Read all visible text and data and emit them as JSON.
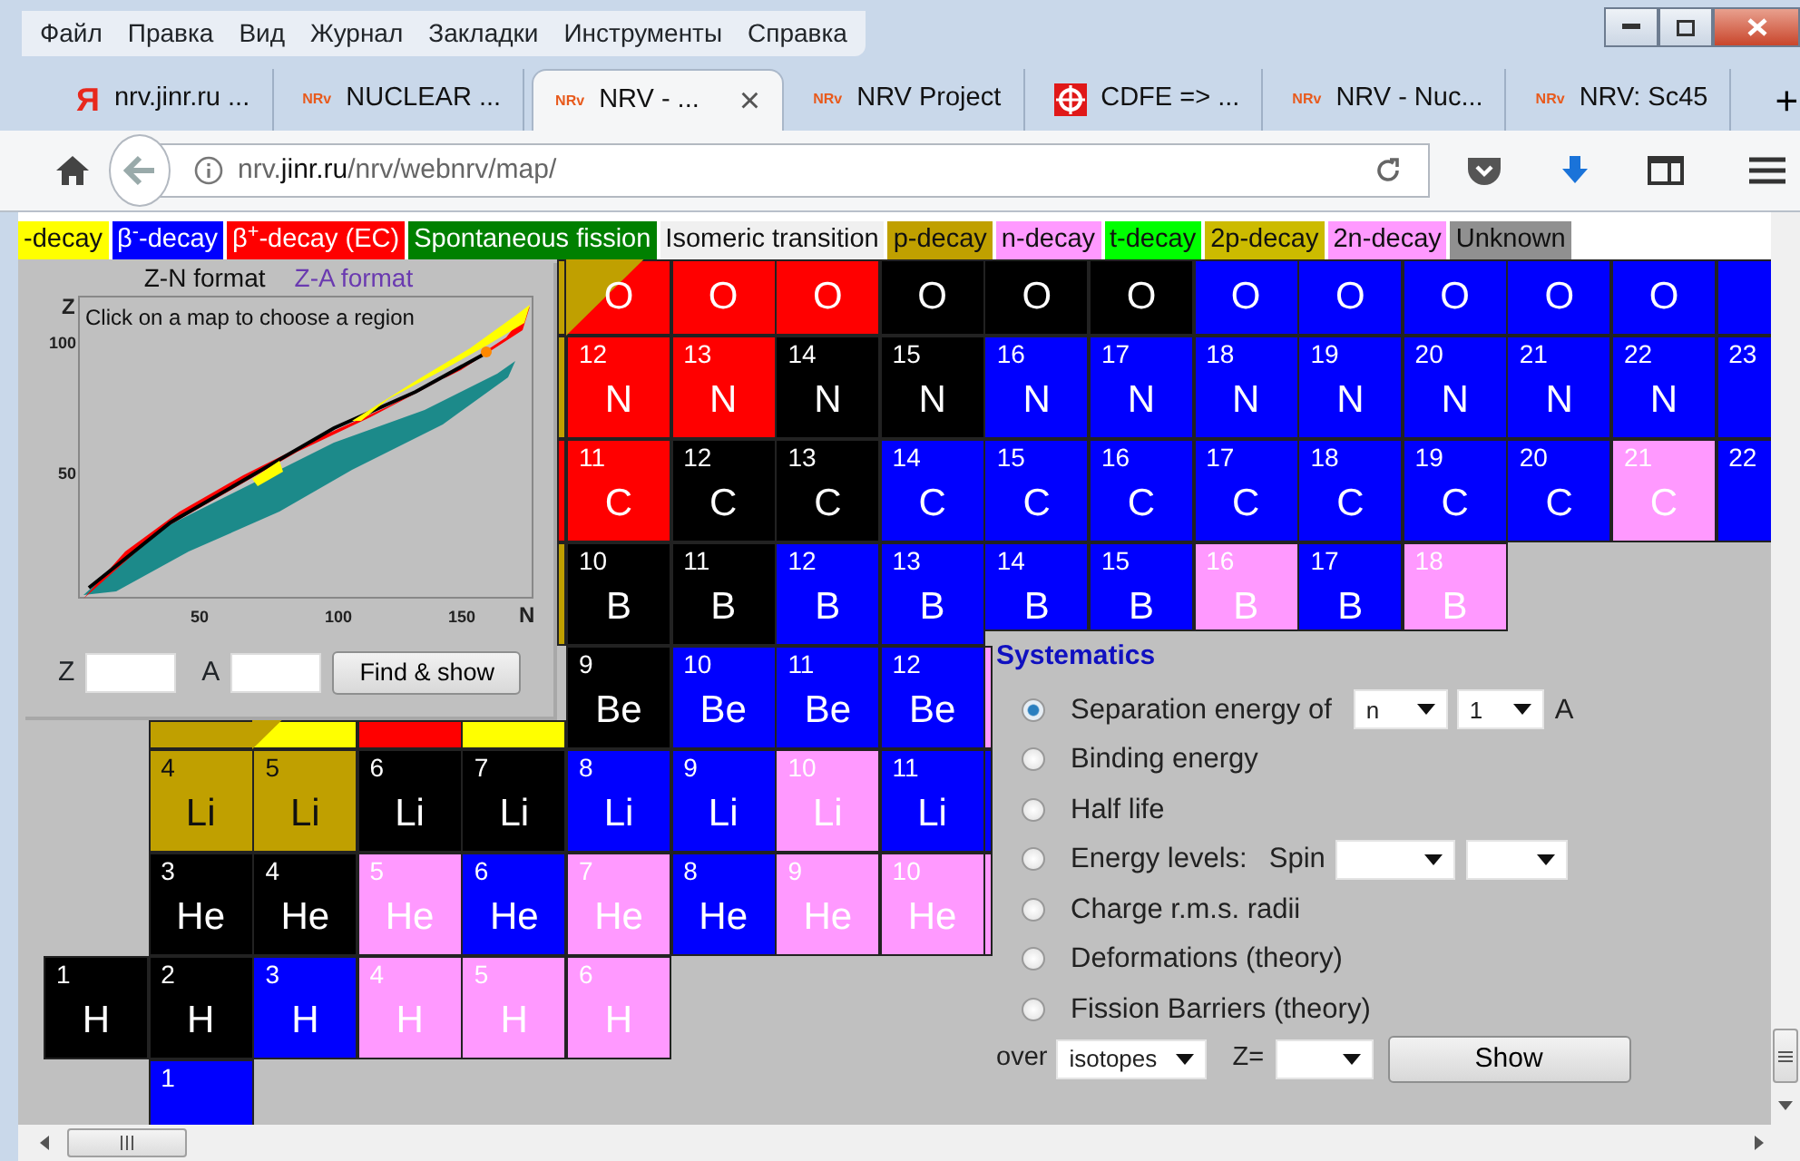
{
  "menu_bar": [
    "Файл",
    "Правка",
    "Вид",
    "Журнал",
    "Закладки",
    "Инструменты",
    "Справка"
  ],
  "tabs": [
    {
      "title": "nrv.jinr.ru ...",
      "favicon": {
        "kind": "yandex",
        "glyph": "Я"
      },
      "selected": false
    },
    {
      "title": "NUCLEAR ...",
      "favicon": {
        "kind": "nrv",
        "glyph": "NRv"
      },
      "selected": false
    },
    {
      "title": "NRV - ...",
      "favicon": {
        "kind": "nrv",
        "glyph": "NRv"
      },
      "selected": true,
      "close": "×"
    },
    {
      "title": "NRV Project",
      "favicon": {
        "kind": "nrv",
        "glyph": "NRv"
      },
      "selected": false
    },
    {
      "title": "CDFE => ...",
      "favicon": {
        "kind": "cdfe"
      },
      "selected": false
    },
    {
      "title": "NRV - Nuc...",
      "favicon": {
        "kind": "nrv",
        "glyph": "NRv"
      },
      "selected": false
    },
    {
      "title": "NRV: Sc45",
      "favicon": {
        "kind": "nrv",
        "glyph": "NRv"
      },
      "selected": false
    }
  ],
  "new_tab": "+",
  "address_bar": {
    "url": "nrv.**jinr.ru**/nrv/webnrv/map/"
  },
  "legend": [
    {
      "label": "-decay",
      "color": "#ffff00"
    },
    {
      "label": "β$^{-}$-decay",
      "color": "#0000ff"
    },
    {
      "label": "β$^{+}$-decay (EC)",
      "color": "#ff0000"
    },
    {
      "label": "Spontaneous fission",
      "color": "#008000"
    },
    {
      "label": "Isomeric transition",
      "color": "#f0f0f0"
    },
    {
      "label": "p-decay",
      "color": "#c0a000"
    },
    {
      "label": "n-decay",
      "color": "#ff99ff"
    },
    {
      "label": "t-decay",
      "color": "#00ff00"
    },
    {
      "label": "2p-decay",
      "color": "#ccbb00"
    },
    {
      "label": "2n-decay",
      "color": "#ff99ff"
    },
    {
      "label": "Unknown",
      "color": "#909090"
    }
  ],
  "map_panel": {
    "formats": [
      {
        "label": "Z-N format",
        "selected": true
      },
      {
        "label": "Z-A format",
        "selected": false
      }
    ],
    "hint": "Click on a map to choose a region",
    "y_axis": "Z",
    "y_ticks": [
      "100",
      "50"
    ],
    "x_ticks": [
      "50",
      "100",
      "150"
    ],
    "x_axis": "N",
    "z_label": "Z",
    "a_label": "A",
    "find_button": "Find & show"
  },
  "chart": {
    "rows": [
      {
        "cells": [
          null,
          null,
          null,
          null,
          {
            "color": "#c0a000"
          },
          {
            "symbol": "O",
            "color": "#ff0000",
            "corner": {
              "color": "#c0a000"
            }
          },
          {
            "symbol": "O",
            "color": "#ff0000"
          },
          {
            "symbol": "O",
            "color": "#ff0000"
          },
          {
            "symbol": "O",
            "color": "#000000"
          },
          {
            "symbol": "O",
            "color": "#000000"
          },
          {
            "symbol": "O",
            "color": "#000000"
          },
          {
            "symbol": "O",
            "color": "#0000ff"
          },
          {
            "symbol": "O",
            "color": "#0000ff"
          },
          {
            "symbol": "O",
            "color": "#0000ff"
          },
          {
            "symbol": "O",
            "color": "#0000ff"
          },
          {
            "symbol": "O",
            "color": "#0000ff"
          },
          {
            "color": "#0000ff"
          }
        ]
      },
      {
        "cells": [
          null,
          null,
          null,
          null,
          {
            "color": "#c0a000"
          },
          {
            "number": "12",
            "symbol": "N",
            "color": "#ff0000"
          },
          {
            "number": "13",
            "symbol": "N",
            "color": "#ff0000"
          },
          {
            "number": "14",
            "symbol": "N",
            "color": "#000000"
          },
          {
            "number": "15",
            "symbol": "N",
            "color": "#000000"
          },
          {
            "number": "16",
            "symbol": "N",
            "color": "#0000ff"
          },
          {
            "number": "17",
            "symbol": "N",
            "color": "#0000ff"
          },
          {
            "number": "18",
            "symbol": "N",
            "color": "#0000ff"
          },
          {
            "number": "19",
            "symbol": "N",
            "color": "#0000ff"
          },
          {
            "number": "20",
            "symbol": "N",
            "color": "#0000ff"
          },
          {
            "number": "21",
            "symbol": "N",
            "color": "#0000ff"
          },
          {
            "number": "22",
            "symbol": "N",
            "color": "#0000ff"
          },
          {
            "number": "23",
            "color": "#0000ff"
          }
        ]
      },
      {
        "cells": [
          null,
          null,
          null,
          null,
          {
            "color": "#ff0000"
          },
          {
            "number": "11",
            "symbol": "C",
            "color": "#ff0000"
          },
          {
            "number": "12",
            "symbol": "C",
            "color": "#000000"
          },
          {
            "number": "13",
            "symbol": "C",
            "color": "#000000"
          },
          {
            "number": "14",
            "symbol": "C",
            "color": "#0000ff"
          },
          {
            "number": "15",
            "symbol": "C",
            "color": "#0000ff"
          },
          {
            "number": "16",
            "symbol": "C",
            "color": "#0000ff"
          },
          {
            "number": "17",
            "symbol": "C",
            "color": "#0000ff"
          },
          {
            "number": "18",
            "symbol": "C",
            "color": "#0000ff"
          },
          {
            "number": "19",
            "symbol": "C",
            "color": "#0000ff"
          },
          {
            "number": "20",
            "symbol": "C",
            "color": "#0000ff"
          },
          {
            "number": "21",
            "symbol": "C",
            "color": "#ff99ff"
          },
          {
            "number": "22",
            "color": "#0000ff"
          }
        ]
      },
      {
        "cells": [
          null,
          null,
          null,
          null,
          {
            "color": "#c0a000"
          },
          {
            "number": "10",
            "symbol": "B",
            "color": "#000000"
          },
          {
            "number": "11",
            "symbol": "B",
            "color": "#000000"
          },
          {
            "number": "12",
            "symbol": "B",
            "color": "#0000ff"
          },
          {
            "number": "13",
            "symbol": "B",
            "color": "#0000ff"
          },
          {
            "number": "14",
            "symbol": "B",
            "color": "#0000ff"
          },
          {
            "number": "15",
            "symbol": "B",
            "color": "#0000ff"
          },
          {
            "number": "16",
            "symbol": "B",
            "color": "#ff99ff"
          },
          {
            "number": "17",
            "symbol": "B",
            "color": "#0000ff"
          },
          {
            "number": "18",
            "symbol": "B",
            "color": "#ff99ff"
          }
        ]
      },
      {
        "cells": [
          null,
          {
            "color": "#c0a000"
          },
          {
            "color": "#ffff00",
            "corner": {
              "color": "#c0a000"
            }
          },
          {
            "color": "#ff0000"
          },
          {
            "color": "#ffff00"
          },
          {
            "number": "9",
            "symbol": "Be",
            "color": "#000000"
          },
          {
            "number": "10",
            "symbol": "Be",
            "color": "#0000ff"
          },
          {
            "number": "11",
            "symbol": "Be",
            "color": "#0000ff"
          },
          {
            "number": "12",
            "symbol": "Be",
            "color": "#0000ff"
          },
          {
            "color": "#ff99ff"
          }
        ]
      },
      {
        "cells": [
          null,
          {
            "number": "4",
            "symbol": "Li",
            "color": "#c0a000"
          },
          {
            "number": "5",
            "symbol": "Li",
            "color": "#c0a000"
          },
          {
            "number": "6",
            "symbol": "Li",
            "color": "#000000"
          },
          {
            "number": "7",
            "symbol": "Li",
            "color": "#000000"
          },
          {
            "number": "8",
            "symbol": "Li",
            "color": "#0000ff"
          },
          {
            "number": "9",
            "symbol": "Li",
            "color": "#0000ff"
          },
          {
            "number": "10",
            "symbol": "Li",
            "color": "#ff99ff"
          },
          {
            "number": "11",
            "symbol": "Li",
            "color": "#0000ff"
          },
          {
            "color": "#0000ff"
          }
        ]
      },
      {
        "cells": [
          null,
          {
            "number": "3",
            "symbol": "He",
            "color": "#000000"
          },
          {
            "number": "4",
            "symbol": "He",
            "color": "#000000"
          },
          {
            "number": "5",
            "symbol": "He",
            "color": "#ff99ff"
          },
          {
            "number": "6",
            "symbol": "He",
            "color": "#0000ff"
          },
          {
            "number": "7",
            "symbol": "He",
            "color": "#ff99ff"
          },
          {
            "number": "8",
            "symbol": "He",
            "color": "#0000ff"
          },
          {
            "number": "9",
            "symbol": "He",
            "color": "#ff99ff"
          },
          {
            "number": "10",
            "symbol": "He",
            "color": "#ff99ff"
          },
          {
            "color": "#ff99ff"
          }
        ]
      },
      {
        "cells": [
          {
            "number": "1",
            "symbol": "H",
            "color": "#000000"
          },
          {
            "number": "2",
            "symbol": "H",
            "color": "#000000"
          },
          {
            "number": "3",
            "symbol": "H",
            "color": "#0000ff"
          },
          {
            "number": "4",
            "symbol": "H",
            "color": "#ff99ff"
          },
          {
            "number": "5",
            "symbol": "H",
            "color": "#ff99ff"
          },
          {
            "number": "6",
            "symbol": "H",
            "color": "#ff99ff"
          }
        ]
      },
      {
        "cells": [
          null,
          {
            "number": "1",
            "color": "#0000ff"
          }
        ]
      }
    ]
  },
  "systematics": {
    "title": "Systematics",
    "options": [
      {
        "kind": "separation",
        "label": "Separation energy of",
        "selected": true
      },
      {
        "kind": "plain",
        "label": "Binding energy",
        "selected": false
      },
      {
        "kind": "plain",
        "label": "Half life",
        "selected": false
      },
      {
        "kind": "levels",
        "label": "Energy levels:",
        "selected": false
      },
      {
        "kind": "plain",
        "label": "Charge r.m.s. radii",
        "selected": false
      },
      {
        "kind": "plain",
        "label": "Deformations (theory)",
        "selected": false
      },
      {
        "kind": "plain",
        "label": "Fission Barriers (theory)",
        "selected": false
      }
    ],
    "particle": "n",
    "count": "1",
    "unit": "A",
    "spin_label": "Spin",
    "over_label": "over",
    "over_value": "isotopes",
    "z_label": "Z=",
    "show_button": "Show"
  }
}
